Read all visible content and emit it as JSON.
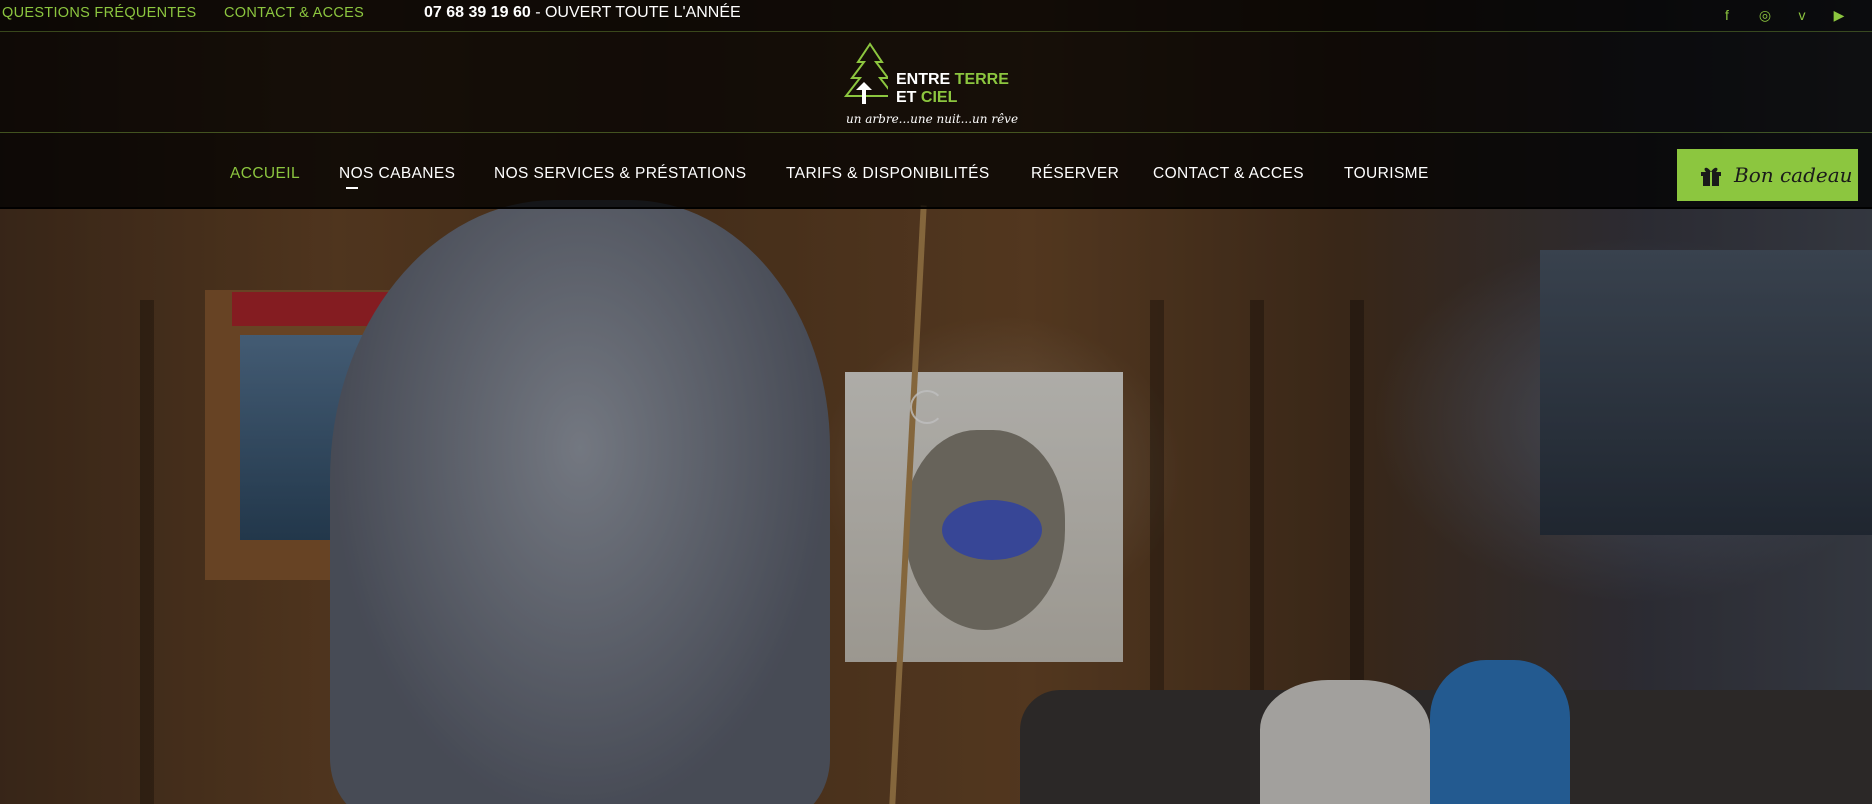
{
  "topbar": {
    "faq_link": "QUESTIONS FRÉQUENTES",
    "contact_link": "CONTACT & ACCES",
    "phone": "07 68 39 19 60",
    "phone_suffix": " - OUVERT TOUTE L'ANNÉE",
    "social": [
      {
        "icon": "facebook-icon",
        "glyph": "f"
      },
      {
        "icon": "instagram-icon",
        "glyph": "◎"
      },
      {
        "icon": "vimeo-icon",
        "glyph": "v"
      },
      {
        "icon": "youtube-icon",
        "glyph": "▶"
      }
    ]
  },
  "logo": {
    "line1_a": "ENTRE ",
    "line1_b": "TERRE",
    "line2_a": "ET ",
    "line2_b": "CIEL",
    "tagline": "un arbre...une nuit...un rêve"
  },
  "nav": {
    "items": [
      {
        "label": "ACCUEIL",
        "active": true
      },
      {
        "label": "NOS CABANES"
      },
      {
        "label": "NOS SERVICES & PRÉSTATIONS"
      },
      {
        "label": "TARIFS & DISPONIBILITÉS"
      },
      {
        "label": "RÉSERVER"
      },
      {
        "label": "CONTACT & ACCES"
      },
      {
        "label": "TOURISME"
      }
    ],
    "gift_button": "Bon cadeau"
  },
  "colors": {
    "accent": "#8cc63f",
    "bar_bg": "#000000",
    "text": "#ffffff"
  }
}
